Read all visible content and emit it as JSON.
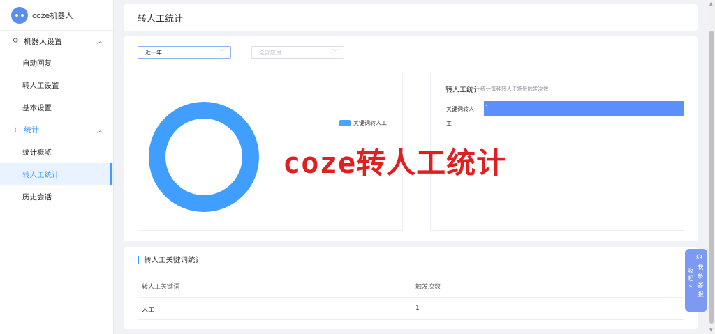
{
  "app": {
    "name": "coze机器人",
    "icon": "robot-icon"
  },
  "sidebar": {
    "groups": [
      {
        "label": "机器人设置",
        "icon": "gear-icon",
        "items": [
          "自动回复",
          "转人工设置",
          "基本设置"
        ]
      },
      {
        "label": "统计",
        "icon": "line-chart-icon",
        "items": [
          "统计概览",
          "转人工统计",
          "历史会话"
        ]
      }
    ],
    "selected": "转人工统计"
  },
  "header": {
    "title": "转人工统计"
  },
  "filters": {
    "range": {
      "value": "近一年"
    },
    "app": {
      "placeholder": "全部应用"
    }
  },
  "donut": {
    "legend": [
      "关键词转人工"
    ],
    "colors": {
      "ring": "#409eff"
    }
  },
  "bar_chart": {
    "title": "转人工统计",
    "subtitle": "统计每种转人工场景触发次数"
  },
  "chart_data": {
    "type": "bar",
    "orientation": "horizontal",
    "categories": [
      "关键词转人工"
    ],
    "category_lines": [
      "关键词转人",
      "工"
    ],
    "values": [
      1
    ],
    "xlim": [
      0,
      1
    ],
    "color": "#5b8ff9"
  },
  "watermark": "coze转人工统计",
  "keyword_table": {
    "title": "转人工关键词统计",
    "columns": [
      "转人工关键词",
      "触发次数"
    ],
    "rows": [
      [
        "人工",
        "1"
      ]
    ]
  },
  "float_widget": {
    "collapse": "收起",
    "contact": "联系客服"
  }
}
